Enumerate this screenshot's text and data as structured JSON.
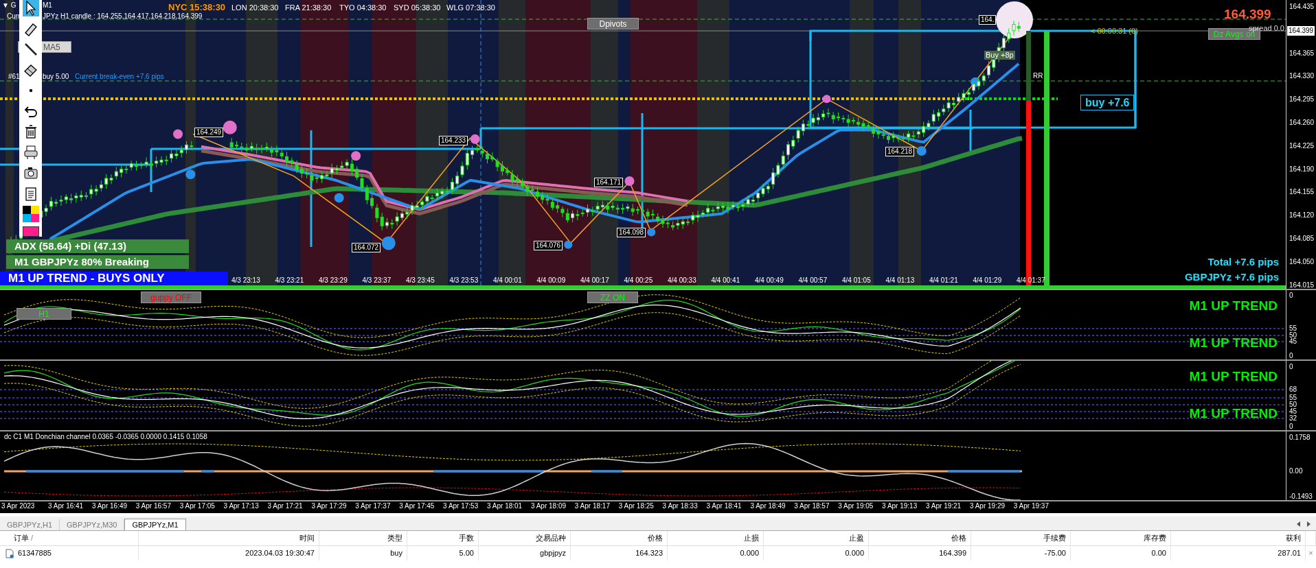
{
  "chart": {
    "title_start": "▼ G",
    "title_end": "M1",
    "candle_info_start": "Curr",
    "candle_info_end": "JPYz H1 candle : 164.255,164.417,164.218,164.399",
    "clocks": [
      {
        "city": "NYC",
        "time": "15:38:30",
        "kind": "current"
      },
      {
        "city": "LON",
        "time": "20:38:30",
        "kind": "other"
      },
      {
        "city": "FRA",
        "time": "21:38:30",
        "kind": "other"
      },
      {
        "city": "TYO",
        "time": "04:38:30",
        "kind": "other"
      },
      {
        "city": "SYD",
        "time": "05:38:30",
        "kind": "other"
      },
      {
        "city": "WLG",
        "time": "07:38:30",
        "kind": "other"
      }
    ],
    "buttons": [
      {
        "label": "Dpivots",
        "kind": "plain"
      },
      {
        "label": "MA5",
        "kind": "light"
      },
      {
        "label": "Dz Avgs on",
        "kind": "on"
      }
    ],
    "order_start": "#61",
    "order_end": "buy 5.00",
    "breakeven": "Current break-even +7.6 pips",
    "price_tags": [
      "164.249",
      "164.233",
      "164.171",
      "164.072",
      "164.076",
      "164.098",
      "164.218",
      "164."
    ],
    "trade_tag": "Buy +8p",
    "rr": "RR",
    "timer": "< 00:00:31 (0)",
    "bid": "164.399",
    "spread": "spread 0.0",
    "position_box": "buy +7.6",
    "total": "Total +7.6 pips",
    "symbol_total": "GBPJPYz +7.6 pips",
    "adx": "ADX (58.64)    +Di (47.13)",
    "breaking": "M1 GBPJPYz 80% Breaking",
    "trend_banner": "M1 UP TREND - BUYS ONLY",
    "price_axis": [
      "164.435",
      "164.365",
      "164.330",
      "164.295",
      "164.260",
      "164.225",
      "164.190",
      "164.155",
      "164.120",
      "164.085",
      "164.050",
      "164.015"
    ],
    "current_price": "164.399",
    "time_axis": [
      "4/3 23:13",
      "4/3 23:21",
      "4/3 23:29",
      "4/3 23:37",
      "4/3 23:45",
      "4/3 23:53",
      "4/4 00:01",
      "4/4 00:09",
      "4/4 00:17",
      "4/4 00:25",
      "4/4 00:33",
      "4/4 00:41",
      "4/4 00:49",
      "4/4 00:57",
      "4/4 01:05",
      "4/4 01:13",
      "4/4 01:21",
      "4/4 01:29",
      "4/4 01:37"
    ]
  },
  "indicators": [
    {
      "kind": "stoch",
      "buttons": [
        {
          "label": "guppy OFF",
          "kind": "off"
        },
        {
          "label": "ZZ ON",
          "kind": "on"
        },
        {
          "label": "H1",
          "kind": "on"
        }
      ],
      "labels": [
        "M1 UP TREND",
        "M1 UP TREND"
      ],
      "axis": [
        "0",
        "55",
        "50",
        "45",
        "0"
      ]
    },
    {
      "kind": "rsi",
      "labels": [
        "M1 UP TREND",
        "M1 UP TREND"
      ],
      "axis": [
        "0",
        "68",
        "55",
        "50",
        "45",
        "32",
        "0"
      ]
    },
    {
      "kind": "donchian",
      "title": "dc C1 M1 Donchian channel 0.0365 -0.0365 0.0000 0.1415 0.1058",
      "axis": [
        "0.1758",
        "0.00",
        "-0.1493"
      ]
    }
  ],
  "time_axis": [
    "3 Apr 2023",
    "3 Apr 16:41",
    "3 Apr 16:49",
    "3 Apr 16:57",
    "3 Apr 17:05",
    "3 Apr 17:13",
    "3 Apr 17:21",
    "3 Apr 17:29",
    "3 Apr 17:37",
    "3 Apr 17:45",
    "3 Apr 17:53",
    "3 Apr 18:01",
    "3 Apr 18:09",
    "3 Apr 18:17",
    "3 Apr 18:25",
    "3 Apr 18:33",
    "3 Apr 18:41",
    "3 Apr 18:49",
    "3 Apr 18:57",
    "3 Apr 19:05",
    "3 Apr 19:13",
    "3 Apr 19:21",
    "3 Apr 19:29",
    "3 Apr 19:37"
  ],
  "tabs": [
    {
      "label": "GBPJPYz,H1",
      "selected": false
    },
    {
      "label": "GBPJPYz,M30",
      "selected": false
    },
    {
      "label": "GBPJPYz,M1",
      "selected": true
    }
  ],
  "table": {
    "columns": [
      "订单",
      "时间",
      "类型",
      "手数",
      "交易品种",
      "价格",
      "止损",
      "止盈",
      "价格",
      "手续费",
      "库存费",
      "获利"
    ],
    "sort_mark": "/",
    "rows": [
      {
        "cells": [
          "61347885",
          "2023.04.03 19:30:47",
          "buy",
          "5.00",
          "gbpjpyz",
          "164.323",
          "0.000",
          "0.000",
          "164.399",
          "-75.00",
          "0.00",
          "287.01"
        ],
        "close": "×"
      }
    ]
  }
}
